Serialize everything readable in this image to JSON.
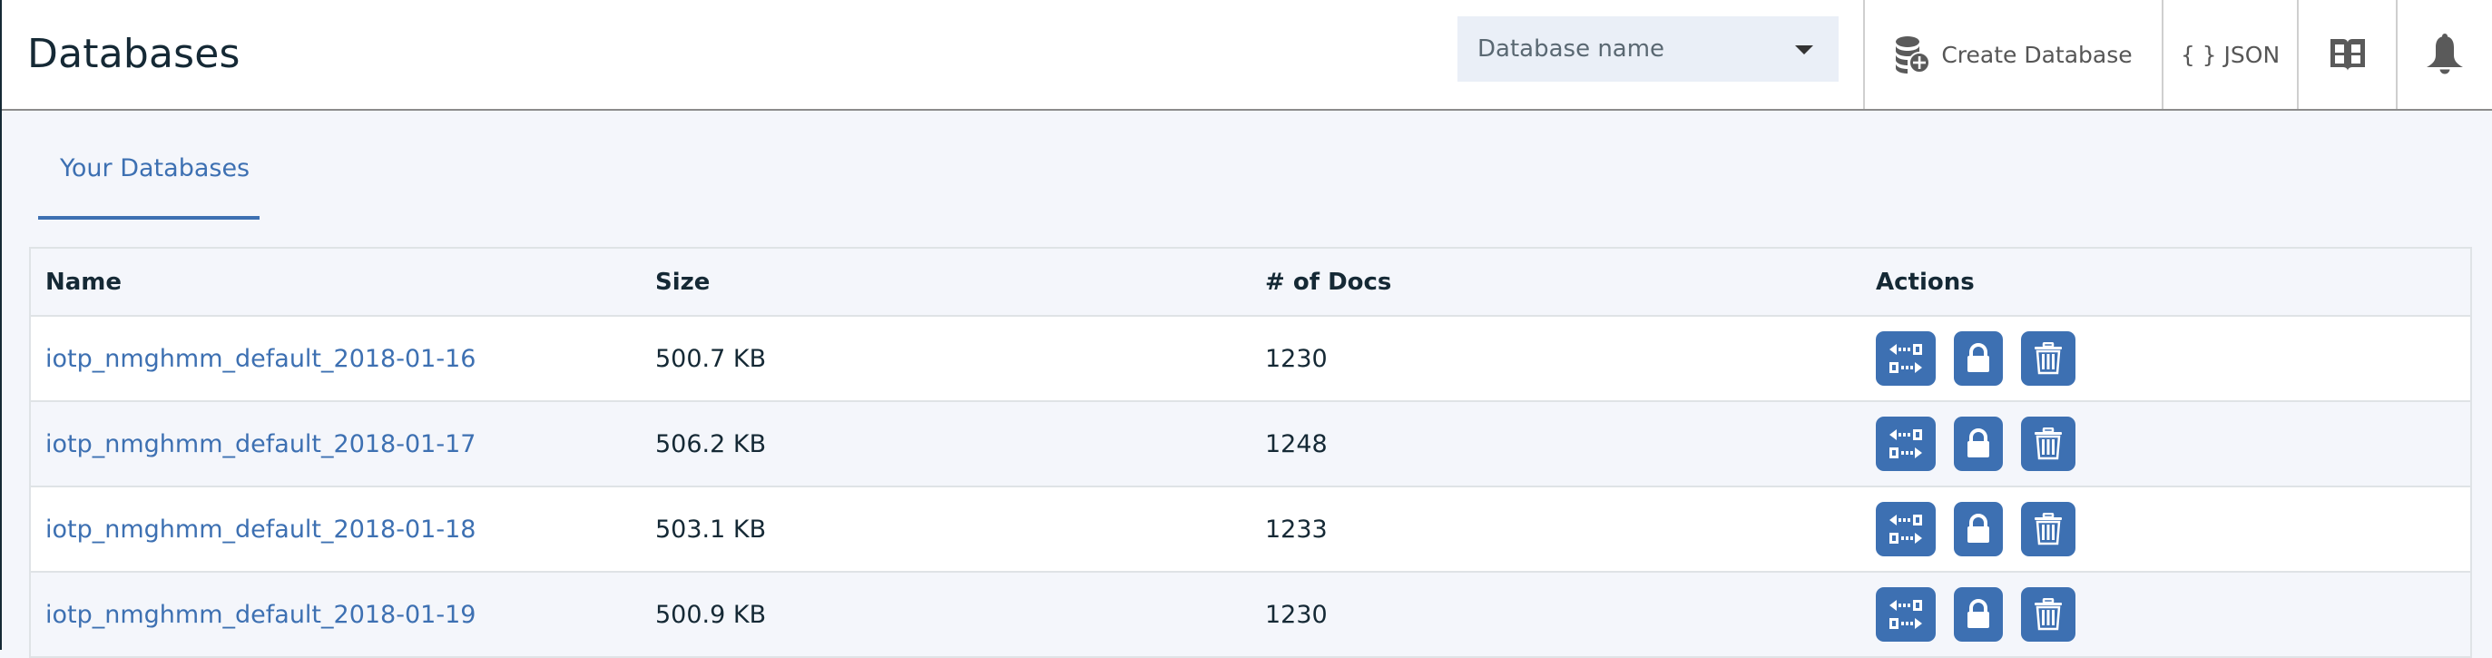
{
  "header": {
    "title": "Databases",
    "db_select": {
      "selected": "Database name",
      "icon": "caret-down-icon"
    },
    "buttons": {
      "create": {
        "label": "Create Database",
        "icon": "database-add-icon"
      },
      "json": {
        "label": "{ } JSON"
      },
      "docs": {
        "icon": "book-icon"
      },
      "notifications": {
        "icon": "bell-icon"
      }
    }
  },
  "tabs": [
    {
      "label": "Your Databases",
      "active": true
    }
  ],
  "table": {
    "columns": [
      "Name",
      "Size",
      "# of Docs",
      "Actions"
    ],
    "rows": [
      {
        "name": "iotp_nmghmm_default_2018-01-16",
        "size": "500.7 KB",
        "docs": "1230"
      },
      {
        "name": "iotp_nmghmm_default_2018-01-17",
        "size": "506.2 KB",
        "docs": "1248"
      },
      {
        "name": "iotp_nmghmm_default_2018-01-18",
        "size": "503.1 KB",
        "docs": "1233"
      },
      {
        "name": "iotp_nmghmm_default_2018-01-19",
        "size": "500.9 KB",
        "docs": "1230"
      }
    ],
    "actions": [
      {
        "name": "replicate",
        "icon": "replicate-icon"
      },
      {
        "name": "permissions",
        "icon": "lock-icon"
      },
      {
        "name": "delete",
        "icon": "trash-icon"
      }
    ]
  },
  "colors": {
    "accent": "#3d70b2",
    "title": "#152935",
    "icon": "#5a5a5a",
    "select_bg": "#eaeff7"
  }
}
